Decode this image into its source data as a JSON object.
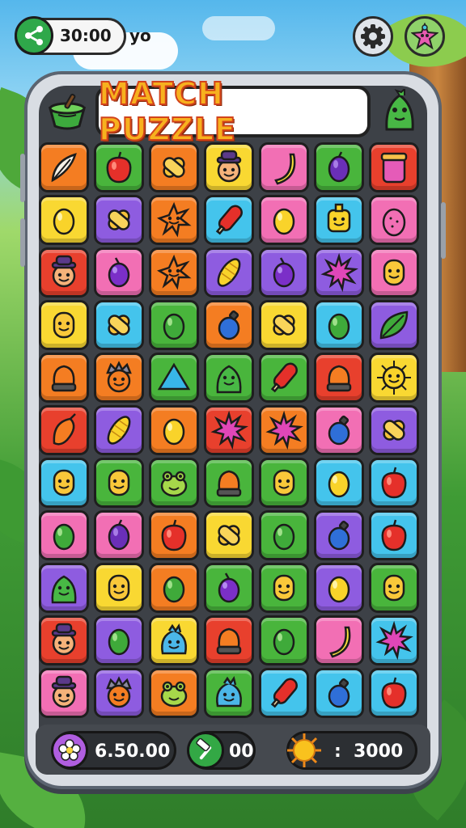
{
  "top_bar": {
    "timer": "30:00",
    "suffix": "yo",
    "share_icon": "share-icon",
    "settings_icon": "gear-icon",
    "profile_icon": "star-creature-icon"
  },
  "header": {
    "title": "MATCH PUZZLE"
  },
  "board": {
    "columns": 7,
    "rows": 11,
    "tiles": [
      [
        "feather",
        "orange"
      ],
      [
        "apple",
        "green"
      ],
      [
        "candy",
        "orange"
      ],
      [
        "man-hat",
        "yellow"
      ],
      [
        "banana",
        "pink"
      ],
      [
        "grape",
        "green"
      ],
      [
        "jar",
        "red"
      ],
      [
        "lemon",
        "yellow"
      ],
      [
        "candy",
        "purple"
      ],
      [
        "sun-star",
        "orange"
      ],
      [
        "popsicle",
        "cyan"
      ],
      [
        "lemon",
        "pink"
      ],
      [
        "robot",
        "cyan"
      ],
      [
        "dragonfruit",
        "pink"
      ],
      [
        "man-hat",
        "red"
      ],
      [
        "plum",
        "pink"
      ],
      [
        "sun-star",
        "orange"
      ],
      [
        "corn",
        "purple"
      ],
      [
        "plum",
        "purple"
      ],
      [
        "urchin",
        "purple"
      ],
      [
        "face",
        "pink"
      ],
      [
        "face",
        "yellow"
      ],
      [
        "candy",
        "cyan"
      ],
      [
        "egg",
        "green"
      ],
      [
        "bomb",
        "orange"
      ],
      [
        "candy",
        "yellow"
      ],
      [
        "egg",
        "cyan"
      ],
      [
        "leaf",
        "purple"
      ],
      [
        "bell",
        "orange"
      ],
      [
        "spiky-face",
        "orange"
      ],
      [
        "triangle",
        "green"
      ],
      [
        "dino",
        "green"
      ],
      [
        "popsicle",
        "green"
      ],
      [
        "bell",
        "red"
      ],
      [
        "sun-face",
        "yellow"
      ],
      [
        "chili",
        "red"
      ],
      [
        "corn",
        "purple"
      ],
      [
        "lemon",
        "orange"
      ],
      [
        "urchin",
        "red"
      ],
      [
        "urchin",
        "orange"
      ],
      [
        "bomb",
        "pink"
      ],
      [
        "candy",
        "purple"
      ],
      [
        "face",
        "cyan"
      ],
      [
        "face",
        "green"
      ],
      [
        "frog",
        "green"
      ],
      [
        "bell",
        "green"
      ],
      [
        "face",
        "green"
      ],
      [
        "lemon",
        "cyan"
      ],
      [
        "apple",
        "cyan"
      ],
      [
        "egg",
        "pink"
      ],
      [
        "grape",
        "pink"
      ],
      [
        "apple",
        "orange"
      ],
      [
        "candy",
        "yellow"
      ],
      [
        "egg",
        "green"
      ],
      [
        "bomb",
        "purple"
      ],
      [
        "apple",
        "cyan"
      ],
      [
        "dino",
        "purple"
      ],
      [
        "face",
        "yellow"
      ],
      [
        "egg",
        "orange"
      ],
      [
        "plum",
        "green"
      ],
      [
        "face",
        "green"
      ],
      [
        "lemon",
        "purple"
      ],
      [
        "face",
        "green"
      ],
      [
        "man-hat",
        "red"
      ],
      [
        "egg",
        "purple"
      ],
      [
        "blob",
        "yellow"
      ],
      [
        "bell",
        "red"
      ],
      [
        "egg",
        "green"
      ],
      [
        "banana",
        "pink"
      ],
      [
        "urchin",
        "cyan"
      ],
      [
        "man-hat",
        "pink"
      ],
      [
        "spiky-face",
        "purple"
      ],
      [
        "frog",
        "orange"
      ],
      [
        "blob",
        "green"
      ],
      [
        "popsicle",
        "cyan"
      ],
      [
        "bomb",
        "cyan"
      ],
      [
        "apple",
        "cyan"
      ]
    ]
  },
  "footer": {
    "coins": {
      "value": "6.50.00",
      "icon": "flower-icon",
      "color": "#b05ee0"
    },
    "moves": {
      "value": "00",
      "icon": "hammer-icon",
      "color": "#33a845"
    },
    "score": {
      "label": ":",
      "value": "3000",
      "icon": "sun-icon",
      "color": "#f5b71f"
    }
  },
  "palette": {
    "orange": "#f47d22",
    "green": "#49b53c",
    "yellow": "#f9d832",
    "pink": "#f26fb4",
    "red": "#e8402d",
    "purple": "#8e5ce0",
    "cyan": "#44c4ec"
  }
}
